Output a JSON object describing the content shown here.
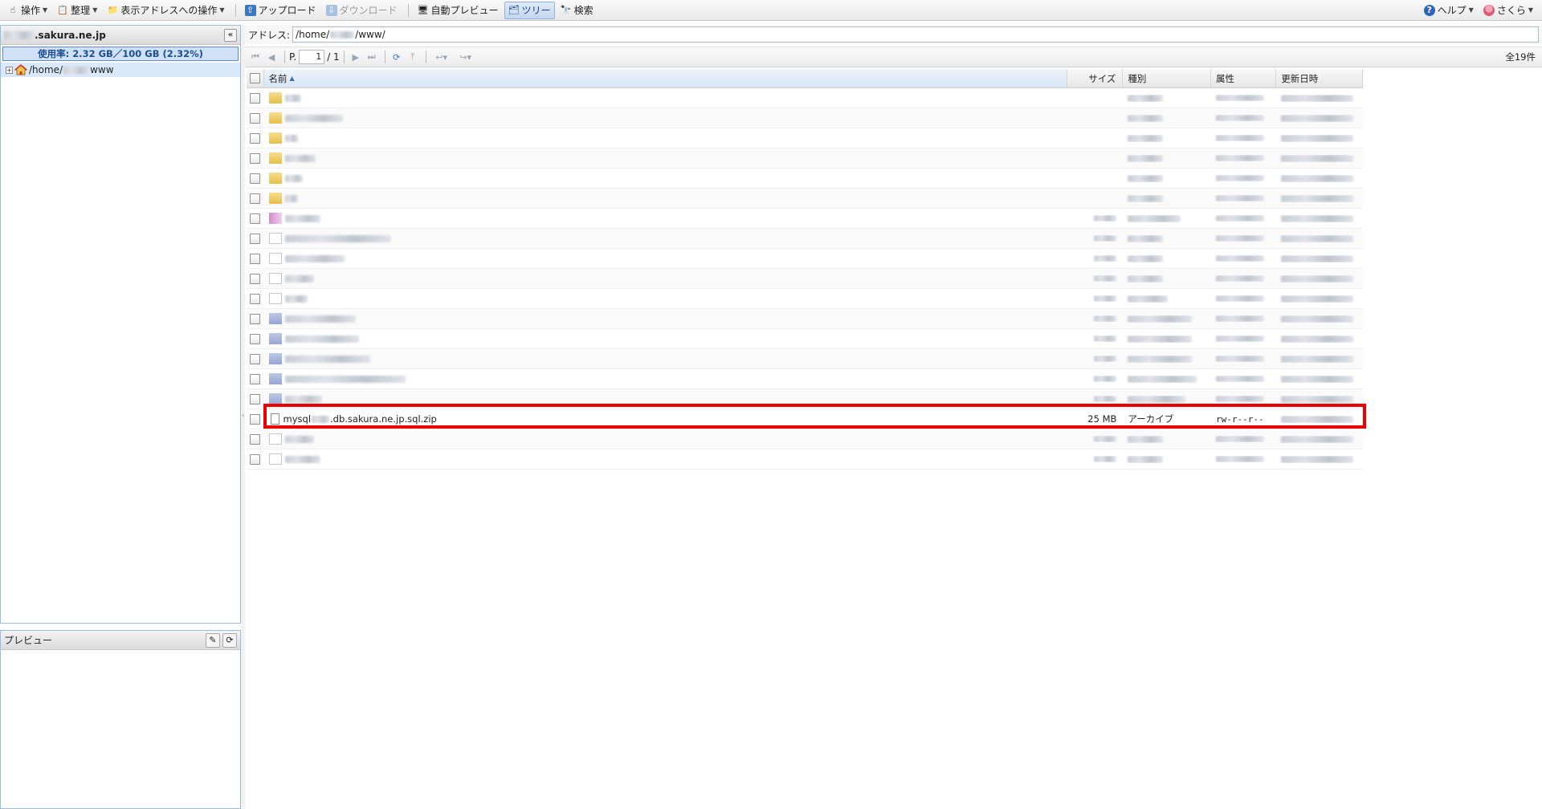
{
  "toolbar": {
    "items": [
      {
        "label": "操作",
        "icon": "hand-icon",
        "caret": true
      },
      {
        "label": "整理",
        "icon": "clipboard-icon",
        "caret": true
      },
      {
        "label": "表示アドレスへの操作",
        "icon": "folder-edit-icon",
        "caret": true
      },
      {
        "label": "アップロード",
        "icon": "upload-icon"
      },
      {
        "label": "ダウンロード",
        "icon": "download-icon",
        "disabled": true
      },
      {
        "label": "自動プレビュー",
        "icon": "monitor-icon"
      },
      {
        "label": "ツリー",
        "icon": "tree-icon",
        "active": true
      },
      {
        "label": "検索",
        "icon": "binoculars-icon"
      }
    ],
    "help_label": "ヘルプ",
    "user_label": "さくら"
  },
  "left": {
    "domain_suffix": ".sakura.ne.jp",
    "usage": "使用率: 2.32 GB／100 GB (2.32%)",
    "tree_root_prefix": "/home/",
    "tree_root_suffix": "www"
  },
  "preview": {
    "title": "プレビュー"
  },
  "address": {
    "label": "アドレス:",
    "prefix": "/home/",
    "suffix": "/www/"
  },
  "pager": {
    "page_prefix": "P.",
    "page_value": "1",
    "page_total": "/ 1",
    "count": "全19件"
  },
  "grid": {
    "headers": {
      "name": "名前",
      "size": "サイズ",
      "type": "種別",
      "attr": "属性",
      "date": "更新日時"
    },
    "rows": [
      {
        "icon": "folder",
        "w": 20,
        "size": "",
        "tw": 44,
        "aw": 60,
        "dw": 90
      },
      {
        "icon": "folder",
        "w": 72,
        "size": "",
        "tw": 44,
        "aw": 60,
        "dw": 90
      },
      {
        "icon": "folder",
        "w": 16,
        "size": "",
        "tw": 44,
        "aw": 60,
        "dw": 90
      },
      {
        "icon": "folder",
        "w": 38,
        "size": "",
        "tw": 44,
        "aw": 60,
        "dw": 90
      },
      {
        "icon": "folder",
        "w": 22,
        "size": "",
        "tw": 44,
        "aw": 60,
        "dw": 90
      },
      {
        "icon": "folder",
        "w": 16,
        "size": "",
        "tw": 44,
        "aw": 60,
        "dw": 90
      },
      {
        "icon": "img",
        "w": 44,
        "size": "",
        "tw": 66,
        "aw": 60,
        "dw": 90
      },
      {
        "icon": "doc",
        "w": 132,
        "size": "",
        "tw": 44,
        "aw": 60,
        "dw": 90
      },
      {
        "icon": "doc",
        "w": 74,
        "size": "",
        "tw": 44,
        "aw": 60,
        "dw": 90
      },
      {
        "icon": "doc",
        "w": 36,
        "size": "",
        "tw": 44,
        "aw": 60,
        "dw": 90
      },
      {
        "icon": "doc",
        "w": 28,
        "size": "",
        "tw": 50,
        "aw": 60,
        "dw": 90
      },
      {
        "icon": "bar",
        "w": 88,
        "size": "",
        "tw": 80,
        "aw": 60,
        "dw": 90
      },
      {
        "icon": "bar",
        "w": 92,
        "size": "",
        "tw": 80,
        "aw": 60,
        "dw": 90
      },
      {
        "icon": "bar",
        "w": 106,
        "size": "",
        "tw": 80,
        "aw": 60,
        "dw": 90
      },
      {
        "icon": "bar",
        "w": 150,
        "size": "",
        "tw": 86,
        "aw": 60,
        "dw": 90
      },
      {
        "icon": "bar",
        "w": 46,
        "size": "",
        "tw": 72,
        "aw": 60,
        "dw": 90
      },
      {
        "icon": "zip",
        "name_prefix": "mysql",
        "name_suffix": ".db.sakura.ne.jp.sql.zip",
        "size": "25 MB",
        "type": "アーカイブ",
        "attr": "rw-r--r--",
        "dw": 90,
        "highlight": true
      },
      {
        "icon": "doc",
        "w": 36,
        "size": "",
        "tw": 44,
        "aw": 60,
        "dw": 90
      },
      {
        "icon": "doc",
        "w": 44,
        "size": "",
        "tw": 44,
        "aw": 60,
        "dw": 90
      }
    ]
  },
  "colors": {
    "accent": "#15428b",
    "highlight": "#ee0000",
    "usage_bg": "#cfe0f7"
  }
}
